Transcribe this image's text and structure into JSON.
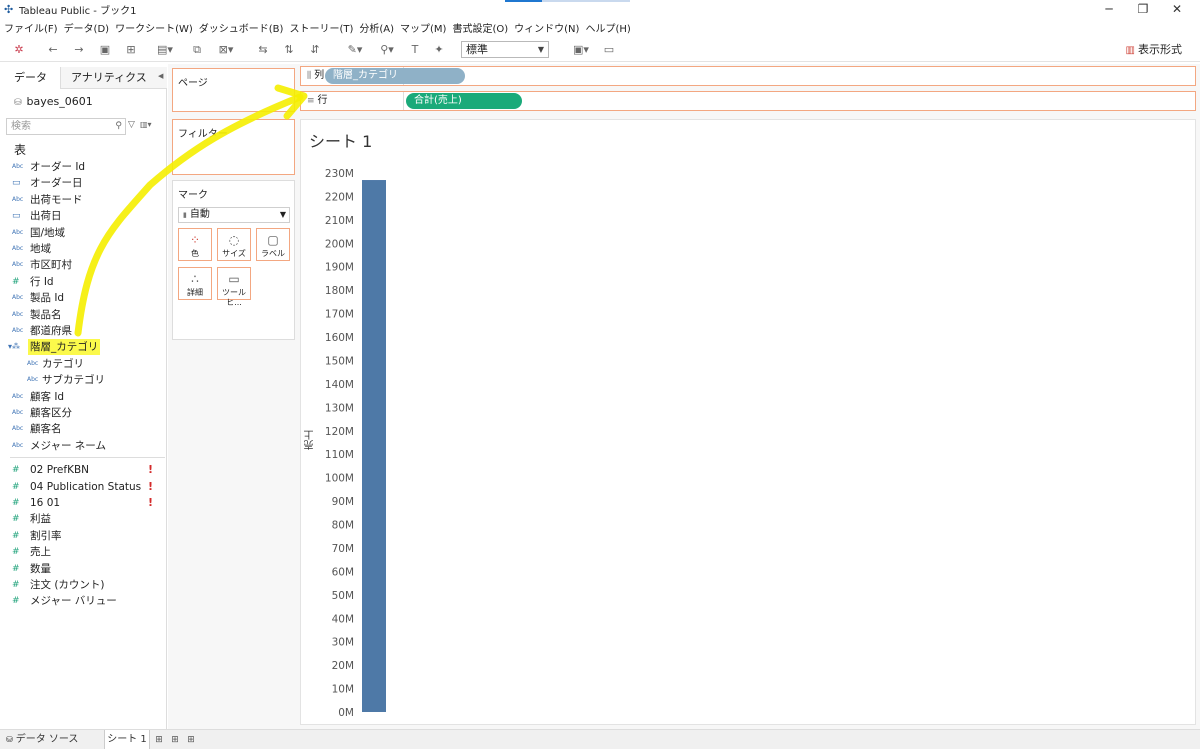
{
  "window": {
    "title": "Tableau Public - ブック1"
  },
  "menu": [
    "ファイル(F)",
    "データ(D)",
    "ワークシート(W)",
    "ダッシュボード(B)",
    "ストーリー(T)",
    "分析(A)",
    "マップ(M)",
    "書式設定(O)",
    "ウィンドウ(N)",
    "ヘルプ(H)"
  ],
  "toolbar": {
    "standard_select": "標準",
    "show_me": "表示形式"
  },
  "left_pane": {
    "tab_data": "データ",
    "tab_analytics": "アナリティクス",
    "datasource": "bayes_0601",
    "search_placeholder": "検索",
    "section_table": "表",
    "dimensions": [
      {
        "type": "Abc",
        "name": "オーダー Id"
      },
      {
        "type": "date",
        "name": "オーダー日"
      },
      {
        "type": "Abc",
        "name": "出荷モード"
      },
      {
        "type": "date",
        "name": "出荷日"
      },
      {
        "type": "Abc",
        "name": "国/地域"
      },
      {
        "type": "Abc",
        "name": "地域"
      },
      {
        "type": "Abc",
        "name": "市区町村"
      },
      {
        "type": "num",
        "name": "行 Id"
      },
      {
        "type": "Abc",
        "name": "製品 Id"
      },
      {
        "type": "Abc",
        "name": "製品名"
      },
      {
        "type": "Abc",
        "name": "都道府県"
      },
      {
        "type": "hier",
        "name": "階層_カテゴリ",
        "highlight": true
      },
      {
        "type": "Abc",
        "name": "カテゴリ",
        "sub": true
      },
      {
        "type": "Abc",
        "name": "サブカテゴリ",
        "sub": true
      },
      {
        "type": "Abc",
        "name": "顧客 Id"
      },
      {
        "type": "Abc",
        "name": "顧客区分"
      },
      {
        "type": "Abc",
        "name": "顧客名"
      },
      {
        "type": "Abc",
        "name": "メジャー ネーム"
      }
    ],
    "measures": [
      {
        "type": "num",
        "name": "02 PrefKBN",
        "warn": true
      },
      {
        "type": "num",
        "name": "04 Publication Status",
        "warn": true
      },
      {
        "type": "num",
        "name": "16 01",
        "warn": true
      },
      {
        "type": "num",
        "name": "利益"
      },
      {
        "type": "num",
        "name": "割引率"
      },
      {
        "type": "num",
        "name": "売上"
      },
      {
        "type": "num",
        "name": "数量"
      },
      {
        "type": "num",
        "name": "注文 (カウント)"
      },
      {
        "type": "num",
        "name": "メジャー バリュー"
      }
    ]
  },
  "shelves": {
    "pages": "ページ",
    "filters": "フィルター",
    "marks": "マーク",
    "marks_type": "自動",
    "mark_buttons": [
      "色",
      "サイズ",
      "ラベル",
      "詳細",
      "ツールヒ..."
    ],
    "columns_label": "列",
    "columns_pill": "階層_カテゴリ",
    "rows_label": "行",
    "rows_pill": "合計(売上)"
  },
  "sheet": {
    "title": "シート 1"
  },
  "chart_data": {
    "type": "bar",
    "categories": [
      ""
    ],
    "values": [
      227
    ],
    "ylabel": "売上",
    "ylim": [
      0,
      230
    ],
    "yticks": [
      "230M",
      "220M",
      "210M",
      "200M",
      "190M",
      "180M",
      "170M",
      "160M",
      "150M",
      "140M",
      "130M",
      "120M",
      "110M",
      "100M",
      "90M",
      "80M",
      "70M",
      "60M",
      "50M",
      "40M",
      "30M",
      "20M",
      "10M",
      "0M"
    ],
    "grid": false,
    "color": "#4e79a7"
  },
  "bottom": {
    "datasource": "データ ソース",
    "sheet_tab": "シート 1"
  },
  "colors": {
    "highlight": "#fbf94b",
    "pill_green": "#1aaa7a",
    "pill_blue": "#8fb1c7",
    "shelf_border": "#f3a781",
    "bar": "#4e79a7"
  }
}
